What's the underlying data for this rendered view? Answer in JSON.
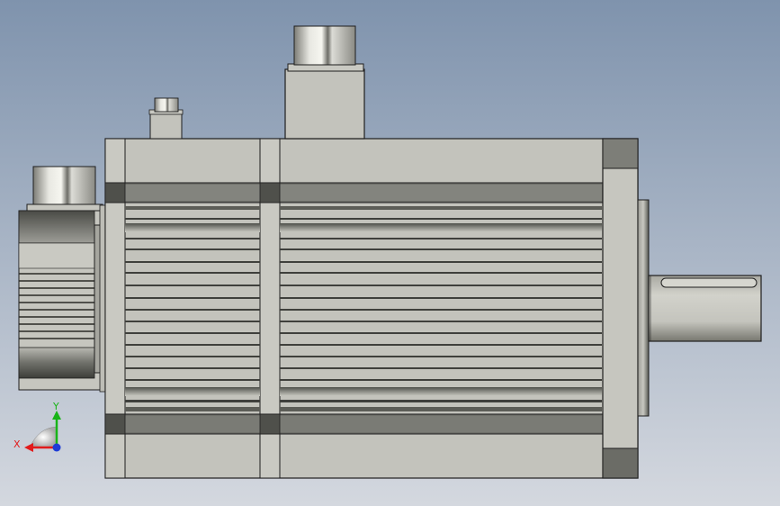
{
  "viewport": {
    "background_top": "#7f93ad",
    "background_bottom": "#d4d8df",
    "model": "servo-motor",
    "view": "front"
  },
  "colors": {
    "body": "#c3c3bc",
    "body_light": "#cfcfc8",
    "rib_dark": "#5d5e58",
    "rib_light": "#bdbdb6",
    "band_dark": "#6e6f69",
    "outline": "#1e1e1e",
    "axis_x": "#e21b1b",
    "axis_y": "#18b418",
    "axis_z": "#1e3cd6"
  },
  "triad": {
    "x_label": "X",
    "y_label": "Y"
  }
}
